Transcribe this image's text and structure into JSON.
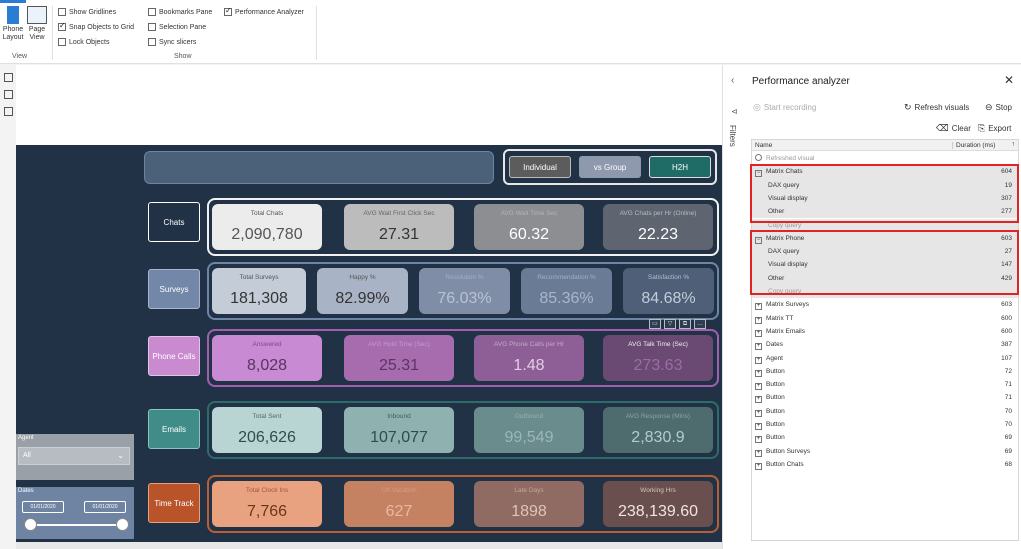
{
  "ribbon": {
    "phone_layout_label": "Phone Layout",
    "page_view_label": "Page View",
    "view_group_label": "View",
    "show_group_label": "Show",
    "checkboxes": [
      {
        "label": "Show Gridlines",
        "checked": false
      },
      {
        "label": "Snap Objects to Grid",
        "checked": true
      },
      {
        "label": "Lock Objects",
        "checked": false
      },
      {
        "label": "Bookmarks Pane",
        "checked": false
      },
      {
        "label": "Selection Pane",
        "checked": false
      },
      {
        "label": "Sync slicers",
        "checked": false
      },
      {
        "label": "Performance Analyzer",
        "checked": true
      }
    ]
  },
  "report": {
    "toggles": [
      "Individual",
      "vs Group",
      "H2H"
    ],
    "rows": [
      {
        "button": "Chats",
        "cards": [
          {
            "label": "Total Chats",
            "value": "2,090,780"
          },
          {
            "label": "AVG Wait First Click Sec",
            "value": "27.31"
          },
          {
            "label": "AVG Wait Time Sec",
            "value": "60.32"
          },
          {
            "label": "AVG Chats per Hr (Online)",
            "value": "22.23"
          }
        ]
      },
      {
        "button": "Surveys",
        "cards": [
          {
            "label": "Total Surveys",
            "value": "181,308"
          },
          {
            "label": "Happy %",
            "value": "82.99%"
          },
          {
            "label": "Resolution %",
            "value": "76.03%"
          },
          {
            "label": "Recommendation %",
            "value": "85.36%"
          },
          {
            "label": "Satisfaction %",
            "value": "84.68%"
          }
        ]
      },
      {
        "button": "Phone Calls",
        "cards": [
          {
            "label": "Answered",
            "value": "8,028"
          },
          {
            "label": "AVG Hold Time (Sec)",
            "value": "25.31"
          },
          {
            "label": "AVG Phone Calls per Hr",
            "value": "1.48"
          },
          {
            "label": "AVG Talk Time (Sec)",
            "value": "273.63"
          }
        ]
      },
      {
        "button": "Emails",
        "cards": [
          {
            "label": "Total Sent",
            "value": "206,626"
          },
          {
            "label": "Inbound",
            "value": "107,077"
          },
          {
            "label": "Outbound",
            "value": "99,549"
          },
          {
            "label": "AVG Response (Mins)",
            "value": "2,830.9"
          }
        ]
      },
      {
        "button": "Time Track",
        "cards": [
          {
            "label": "Total Clock Ins",
            "value": "7,766"
          },
          {
            "label": "Off Vacation",
            "value": "627"
          },
          {
            "label": "Late Days",
            "value": "1898"
          },
          {
            "label": "Working Hrs",
            "value": "238,139.60"
          }
        ]
      }
    ],
    "agent_slicer": {
      "header": "Agent",
      "value": "All",
      "chevron": "⌄"
    },
    "dates_slicer": {
      "header": "Dates",
      "from": "01/01/2020",
      "to": "01/01/2020"
    }
  },
  "filters_label": "Filters",
  "pane": {
    "title": "Performance analyzer",
    "start_recording": "Start recording",
    "refresh_visuals": "Refresh visuals",
    "stop": "Stop",
    "clear": "Clear",
    "export": "Export",
    "col_name": "Name",
    "col_duration": "Duration (ms)",
    "rows": [
      {
        "name": "Refreshed visual",
        "duration": "",
        "type": "faint"
      },
      {
        "name": "Matrix Chats",
        "duration": "604",
        "type": "top-expanded"
      },
      {
        "name": "DAX query",
        "duration": "19",
        "type": "sub"
      },
      {
        "name": "Visual display",
        "duration": "307",
        "type": "sub"
      },
      {
        "name": "Other",
        "duration": "277",
        "type": "sub"
      },
      {
        "name": "Copy query",
        "duration": "",
        "type": "faint-sub"
      },
      {
        "name": "Matrix Phone",
        "duration": "603",
        "type": "top-expanded"
      },
      {
        "name": "DAX query",
        "duration": "27",
        "type": "sub"
      },
      {
        "name": "Visual display",
        "duration": "147",
        "type": "sub"
      },
      {
        "name": "Other",
        "duration": "429",
        "type": "sub"
      },
      {
        "name": "Copy query",
        "duration": "",
        "type": "faint-sub"
      },
      {
        "name": "Matrix Surveys",
        "duration": "603",
        "type": "top"
      },
      {
        "name": "Matrix TT",
        "duration": "600",
        "type": "top"
      },
      {
        "name": "Matrix Emails",
        "duration": "600",
        "type": "top"
      },
      {
        "name": "Dates",
        "duration": "387",
        "type": "top"
      },
      {
        "name": "Agent",
        "duration": "107",
        "type": "top"
      },
      {
        "name": "Button",
        "duration": "72",
        "type": "top"
      },
      {
        "name": "Button",
        "duration": "71",
        "type": "top"
      },
      {
        "name": "Button",
        "duration": "71",
        "type": "top"
      },
      {
        "name": "Button",
        "duration": "70",
        "type": "top"
      },
      {
        "name": "Button",
        "duration": "70",
        "type": "top"
      },
      {
        "name": "Button",
        "duration": "69",
        "type": "top"
      },
      {
        "name": "Button Surveys",
        "duration": "69",
        "type": "top"
      },
      {
        "name": "Button Chats",
        "duration": "68",
        "type": "top"
      }
    ]
  }
}
